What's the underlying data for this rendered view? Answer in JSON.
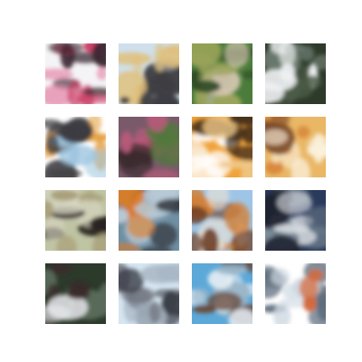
{
  "figure": {
    "rows": 4,
    "cols": 4,
    "tiles": [
      {
        "content": "blurry-generated-sample",
        "palette": [
          "#f4f4f6",
          "#c9345e",
          "#3a2630",
          "#e37aa0"
        ]
      },
      {
        "content": "blurry-generated-sample",
        "palette": [
          "#cfe0ec",
          "#3d3d42",
          "#e0bf7a",
          "#8c8c90"
        ]
      },
      {
        "content": "blurry-generated-sample",
        "palette": [
          "#4b7c3b",
          "#9aa45a",
          "#d9c9b4",
          "#2f4a28"
        ]
      },
      {
        "content": "blurry-generated-sample",
        "palette": [
          "#2d3a2a",
          "#4a5a44",
          "#eef0f2",
          "#6f7f73"
        ]
      },
      {
        "content": "blurry-generated-sample",
        "palette": [
          "#ffffff",
          "#9fc6e0",
          "#e39a35",
          "#3b3b40"
        ]
      },
      {
        "content": "blurry-generated-sample",
        "palette": [
          "#7a5a6a",
          "#4e7a3a",
          "#b85a7a",
          "#3b2a2e"
        ]
      },
      {
        "content": "blurry-generated-sample",
        "palette": [
          "#f0a23a",
          "#eec98a",
          "#3b2a1a",
          "#ffffff"
        ]
      },
      {
        "content": "blurry-generated-sample",
        "palette": [
          "#e9b766",
          "#d98a3a",
          "#7a4a2a",
          "#fbf1dc"
        ]
      },
      {
        "content": "blurry-generated-sample",
        "palette": [
          "#bfc4a3",
          "#2a2420",
          "#a8a07a",
          "#d7d6c2"
        ]
      },
      {
        "content": "blurry-generated-sample",
        "palette": [
          "#6f8fa3",
          "#e07a20",
          "#2a2a30",
          "#b7c9d6"
        ]
      },
      {
        "content": "blurry-generated-sample",
        "palette": [
          "#9ec5e6",
          "#d2813a",
          "#6a3b22",
          "#e9e2d6"
        ]
      },
      {
        "content": "blurry-generated-sample",
        "palette": [
          "#2a3a5a",
          "#d9dde2",
          "#6a7a8a",
          "#1e2230"
        ]
      },
      {
        "content": "blurry-generated-sample",
        "palette": [
          "#2b3a2a",
          "#5a6a5a",
          "#e9ecef",
          "#3a2a2a"
        ]
      },
      {
        "content": "blurry-generated-sample",
        "palette": [
          "#d6e6f1",
          "#6a6e78",
          "#a9b7c5",
          "#3b3f48"
        ]
      },
      {
        "content": "blurry-generated-sample",
        "palette": [
          "#5ca8d8",
          "#e6eef4",
          "#6a4a3a",
          "#9bb7c9"
        ]
      },
      {
        "content": "blurry-generated-sample",
        "palette": [
          "#ffffff",
          "#d46a3a",
          "#5a6a7a",
          "#cfd9e3"
        ]
      }
    ]
  }
}
